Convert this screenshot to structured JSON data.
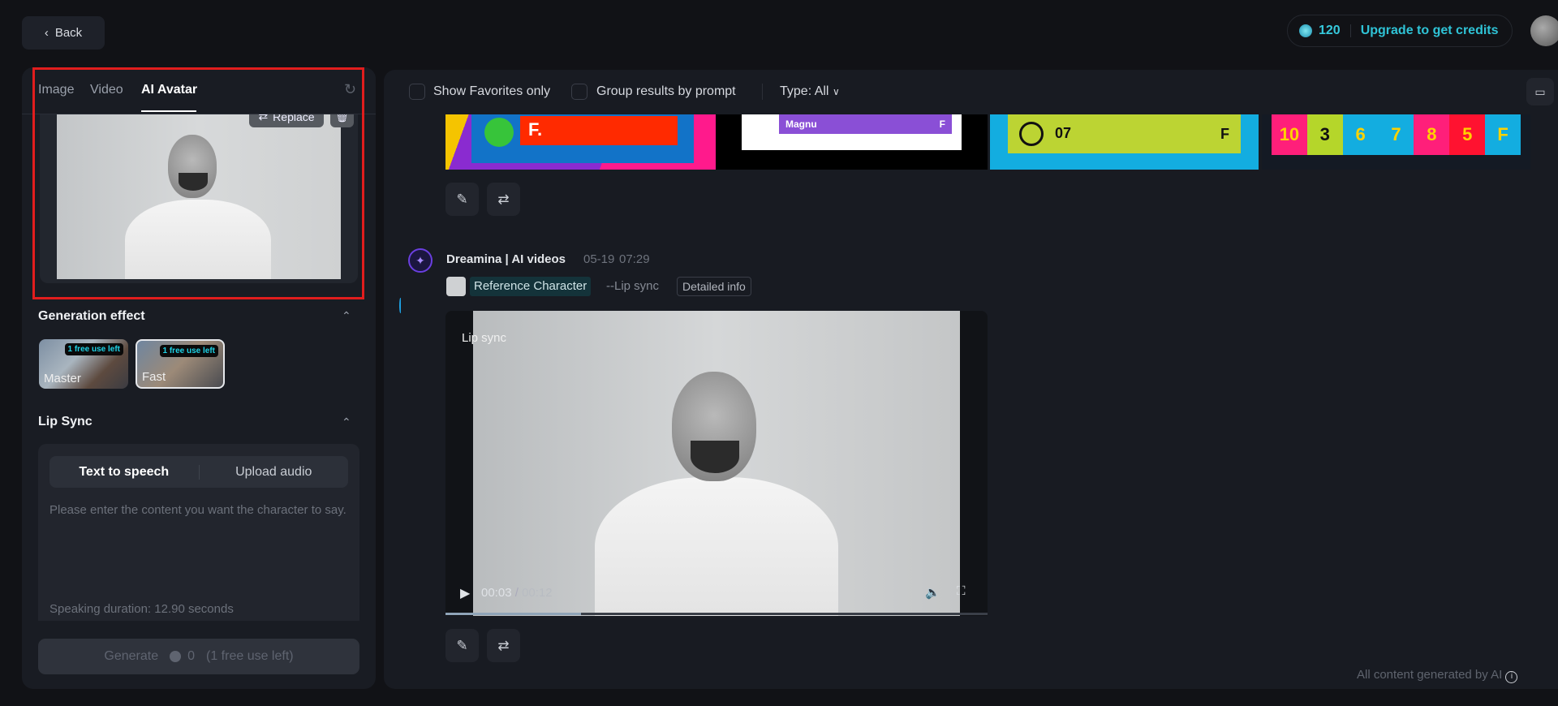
{
  "header": {
    "back_label": "Back",
    "credits": "120",
    "upgrade_label": "Upgrade to get credits"
  },
  "left": {
    "tabs": [
      {
        "label": "Image"
      },
      {
        "label": "Video"
      },
      {
        "label": "AI Avatar"
      }
    ],
    "replace_label": "Replace",
    "generation_effect": {
      "title": "Generation effect",
      "options": [
        {
          "label": "Master",
          "badge": "1 free use left"
        },
        {
          "label": "Fast",
          "badge": "1 free use left"
        }
      ]
    },
    "lip_sync": {
      "title": "Lip Sync",
      "modes": [
        "Text to speech",
        "Upload audio"
      ],
      "placeholder": "Please enter the content you want the character to say.",
      "duration": "Speaking duration: 12.90 seconds"
    },
    "generate": {
      "label": "Generate",
      "cost": "0",
      "note": "(1 free use left)"
    }
  },
  "toolbar": {
    "favorites_label": "Show Favorites only",
    "group_label": "Group results by prompt",
    "type_label": "Type: All"
  },
  "strip": {
    "img1_text": "F.",
    "img2_text": "Magnu",
    "img2_f": "F",
    "img3_num": "07",
    "img3_f": "F",
    "img4_cells": [
      "10",
      "3",
      "6",
      "7",
      "8",
      "5",
      "F"
    ]
  },
  "post": {
    "author": "Dreamina | AI videos",
    "date": "05-19",
    "time": "07:29",
    "ref_label": "Reference Character",
    "mode": "--Lip sync",
    "detail_label": "Detailed info",
    "video": {
      "label": "Lip sync",
      "current": "00:03",
      "separator": "/",
      "total": "00:12",
      "progress": 0.25
    }
  },
  "footer": {
    "note": "All content generated by AI"
  },
  "colors": {
    "accent": "#1fc8db",
    "red_box": "#e11d1d"
  }
}
